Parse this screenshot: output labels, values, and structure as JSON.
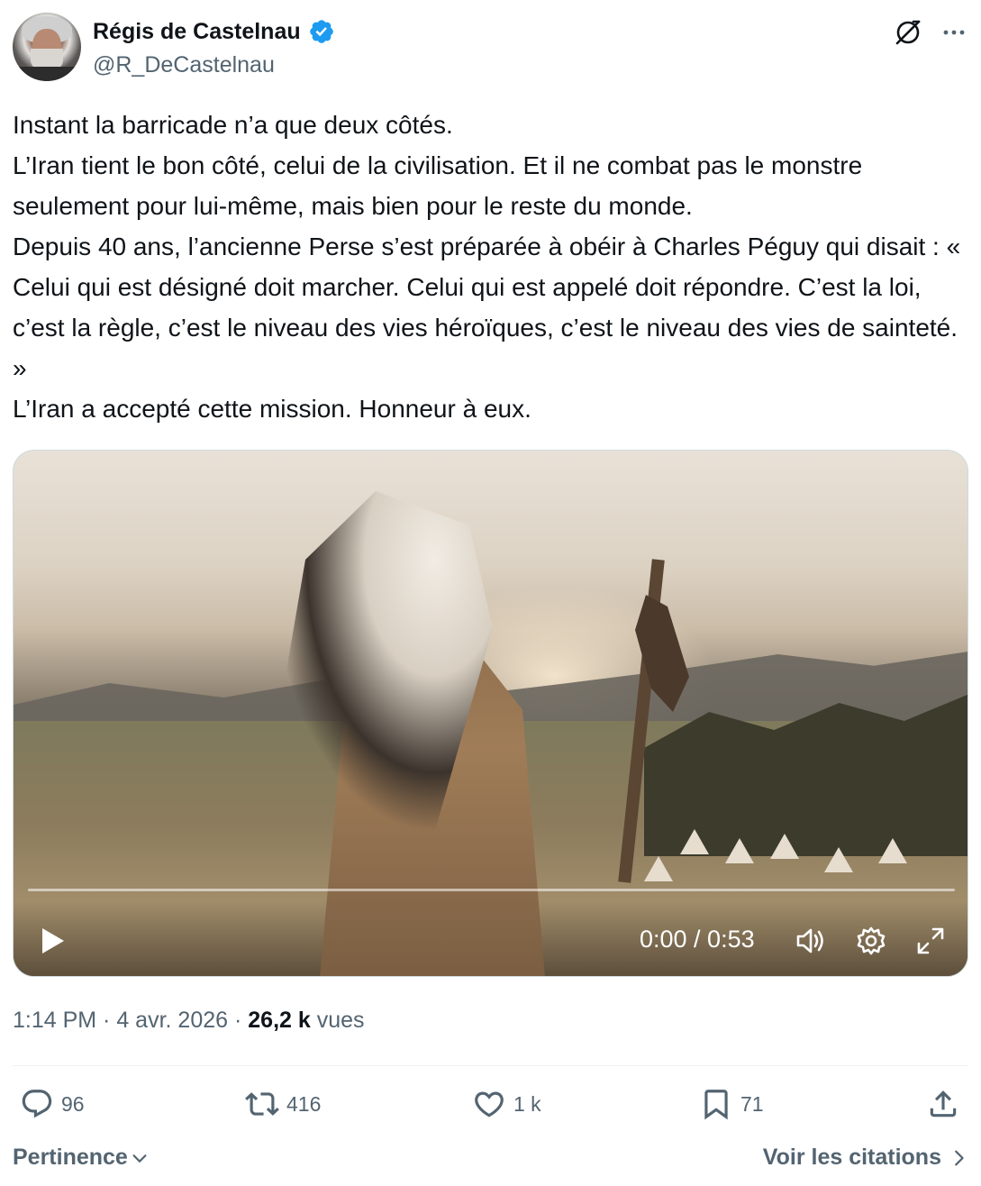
{
  "author": {
    "name": "Régis de Castelnau",
    "handle": "@R_DeCastelnau",
    "verified": true
  },
  "colors": {
    "text": "#0f1419",
    "secondary": "#536471",
    "verified": "#1d9bf0"
  },
  "tweet": {
    "text": "Instant la barricade n’a que deux côtés.\nL’Iran tient le bon côté, celui de la civilisation. Et il ne combat pas le monstre seulement pour lui-même, mais bien pour le reste du monde.\nDepuis 40 ans, l’ancienne Perse s’est préparée à obéir à Charles Péguy qui disait : « Celui qui est désigné doit marcher. Celui qui est appelé doit répondre. C’est la loi, c’est la règle, c’est le niveau des vies héroïques, c’est le niveau des vies de sainteté. »\nL’Iran a accepté cette mission. Honneur à eux."
  },
  "video": {
    "time": "0:00 / 0:53",
    "progress": 0
  },
  "meta": {
    "time": "1:14 PM",
    "separator": " · ",
    "date": "4 avr. 2026",
    "views_count": "26,2 k",
    "views_label": "vues"
  },
  "actions": {
    "replies": "96",
    "reposts": "416",
    "likes": "1 k",
    "bookmarks": "71"
  },
  "footer": {
    "sort_label": "Pertinence",
    "quotes_label": "Voir les citations"
  }
}
